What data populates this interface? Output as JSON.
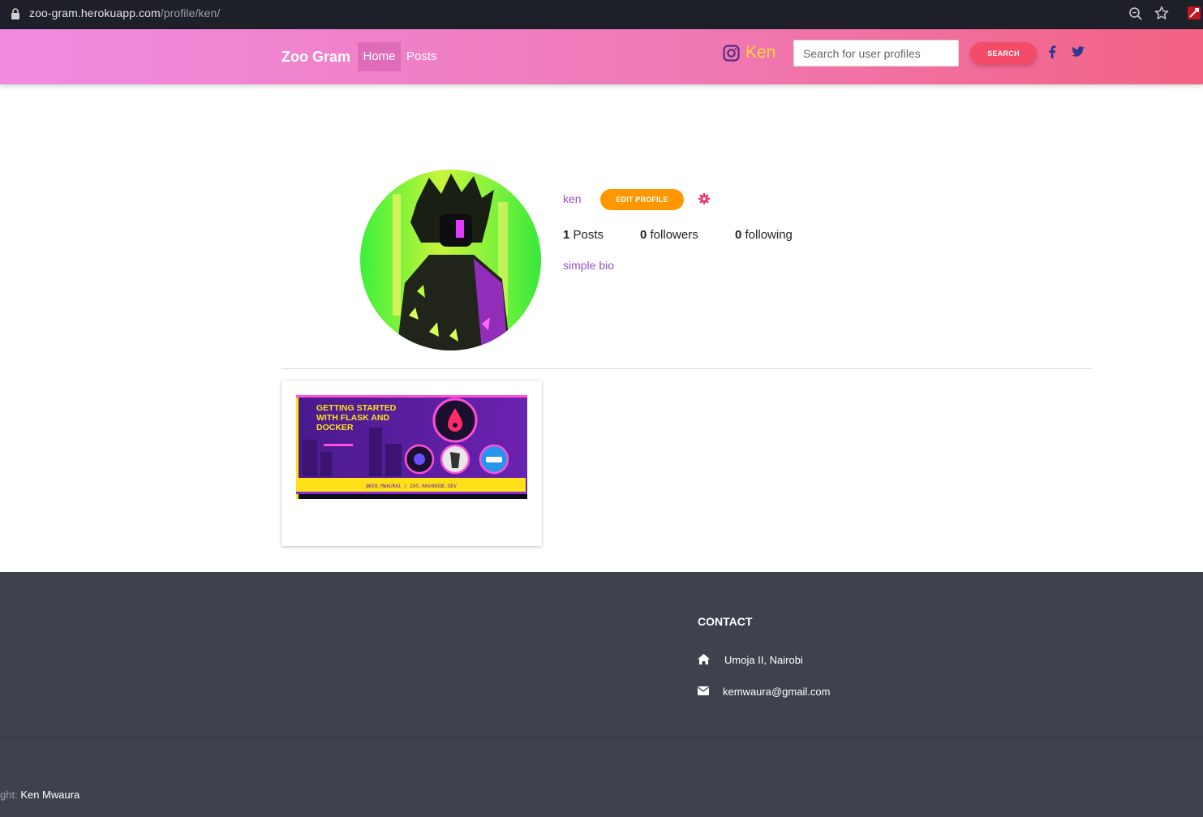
{
  "browser": {
    "url_host": "zoo-gram.herokuapp.com",
    "url_path": "/profile/ken/"
  },
  "navbar": {
    "brand": "Zoo Gram",
    "home_label": "Home",
    "posts_label": "Posts",
    "current_user": "Ken",
    "search_placeholder": "Search for user profiles",
    "search_button": "SEARCH"
  },
  "profile": {
    "username": "ken",
    "edit_button": "EDIT PROFILE",
    "posts_count": "1",
    "posts_label": "Posts",
    "followers_count": "0",
    "followers_label": "followers",
    "following_count": "0",
    "following_label": "following",
    "bio": "simple bio"
  },
  "posts": [
    {
      "banner_title_lines": [
        "GETTING STARTED",
        "WITH FLASK AND",
        "DOCKER"
      ],
      "banner_footer": "@KEN_MWAURA1 | ZOO.HASHNODE.DEV"
    }
  ],
  "footer": {
    "contact_title": "CONTACT",
    "address": "Umoja II, Nairobi",
    "email": "kemwaura@gmail.com",
    "copyright_label": "ght:",
    "copyright_name": "Ken Mwaura"
  },
  "colors": {
    "nav_gradient_start": "#f08be0",
    "nav_gradient_end": "#f26283",
    "accent_purple": "#9c4fc2",
    "edit_orange": "#ff9800",
    "search_red": "#f24c69",
    "footer_bg": "#3d424e"
  }
}
